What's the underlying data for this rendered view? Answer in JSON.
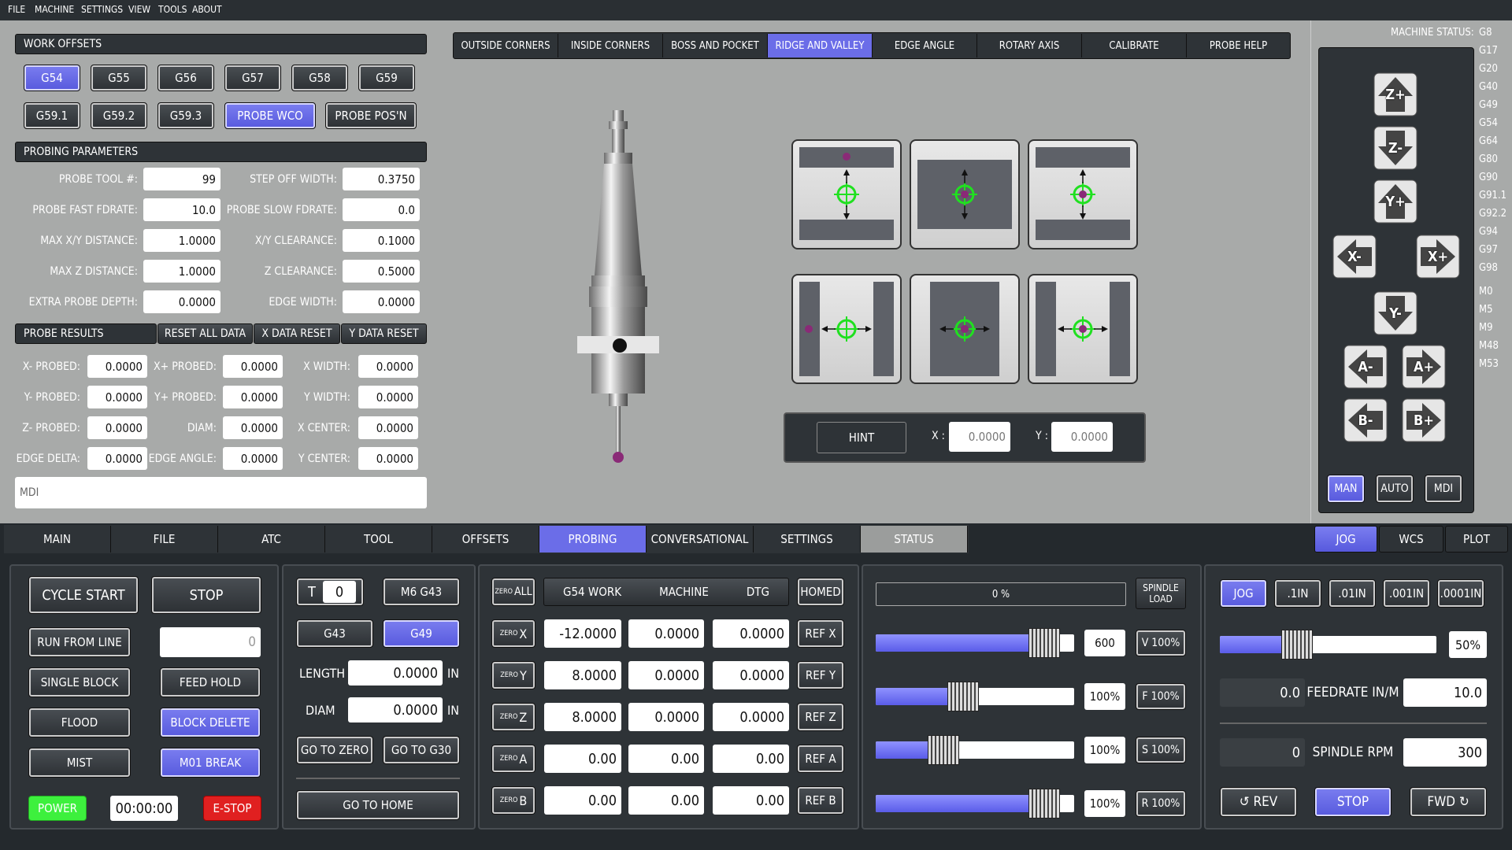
{
  "menu": [
    "FILE",
    "MACHINE",
    "SETTINGS",
    "VIEW",
    "TOOLS",
    "ABOUT"
  ],
  "work_offsets": {
    "title": "WORK OFFSETS",
    "row1": [
      "G54",
      "G55",
      "G56",
      "G57",
      "G58",
      "G59"
    ],
    "row2": [
      "G59.1",
      "G59.2",
      "G59.3",
      "PROBE WCO",
      "PROBE POS'N"
    ],
    "active": "G54"
  },
  "probing_params": {
    "title": "PROBING PARAMETERS",
    "left": [
      {
        "label": "PROBE TOOL #:",
        "value": "99"
      },
      {
        "label": "PROBE FAST FDRATE:",
        "value": "10.0"
      },
      {
        "label": "MAX X/Y DISTANCE:",
        "value": "1.0000"
      },
      {
        "label": "MAX Z DISTANCE:",
        "value": "1.0000"
      },
      {
        "label": "EXTRA PROBE DEPTH:",
        "value": "0.0000"
      }
    ],
    "right": [
      {
        "label": "STEP OFF WIDTH:",
        "value": "0.3750"
      },
      {
        "label": "PROBE SLOW FDRATE:",
        "value": "0.0"
      },
      {
        "label": "X/Y CLEARANCE:",
        "value": "0.1000"
      },
      {
        "label": "Z CLEARANCE:",
        "value": "0.5000"
      },
      {
        "label": "EDGE WIDTH:",
        "value": "0.0000"
      }
    ]
  },
  "probe_results": {
    "title": "PROBE RESULTS",
    "buttons": [
      "RESET ALL DATA",
      "X DATA RESET",
      "Y DATA RESET"
    ],
    "col1": [
      {
        "label": "X- PROBED:",
        "value": "0.0000"
      },
      {
        "label": "Y- PROBED:",
        "value": "0.0000"
      },
      {
        "label": "Z- PROBED:",
        "value": "0.0000"
      },
      {
        "label": "EDGE DELTA:",
        "value": "0.0000"
      }
    ],
    "col2": [
      {
        "label": "X+ PROBED:",
        "value": "0.0000"
      },
      {
        "label": "Y+ PROBED:",
        "value": "0.0000"
      },
      {
        "label": "DIAM:",
        "value": "0.0000"
      },
      {
        "label": "EDGE ANGLE:",
        "value": "0.0000"
      }
    ],
    "col3": [
      {
        "label": "X WIDTH:",
        "value": "0.0000"
      },
      {
        "label": "Y WIDTH:",
        "value": "0.0000"
      },
      {
        "label": "X CENTER:",
        "value": "0.0000"
      },
      {
        "label": "Y CENTER:",
        "value": "0.0000"
      }
    ]
  },
  "mdi": {
    "placeholder": "MDI"
  },
  "probe_tabs": {
    "items": [
      "OUTSIDE CORNERS",
      "INSIDE CORNERS",
      "BOSS AND POCKET",
      "RIDGE AND VALLEY",
      "EDGE ANGLE",
      "ROTARY AXIS",
      "CALIBRATE",
      "PROBE HELP"
    ],
    "active": "RIDGE AND VALLEY"
  },
  "hint": {
    "button": "HINT",
    "x_label": "X :",
    "x_value": "0.0000",
    "y_label": "Y :",
    "y_value": "0.0000"
  },
  "machine_status": {
    "title": "MACHINE STATUS:",
    "gcodes": [
      "G8",
      "G17",
      "G20",
      "G40",
      "G49",
      "G54",
      "G64",
      "G80",
      "G90",
      "G91.1",
      "G92.2",
      "G94",
      "G97",
      "G98"
    ],
    "mcodes": [
      "M0",
      "M5",
      "M9",
      "M48",
      "M53"
    ]
  },
  "jog_keys": [
    "Z+",
    "Z-",
    "Y+",
    "X-",
    "X+",
    "Y-",
    "A-",
    "A+",
    "B-",
    "B+"
  ],
  "modes": {
    "items": [
      "MAN",
      "AUTO",
      "MDI"
    ],
    "active": "MAN"
  },
  "main_tabs": {
    "items": [
      "MAIN",
      "FILE",
      "ATC",
      "TOOL",
      "OFFSETS",
      "PROBING",
      "CONVERSATIONAL",
      "SETTINGS",
      "STATUS"
    ],
    "active": "PROBING"
  },
  "right_tabs": {
    "items": [
      "JOG",
      "WCS",
      "PLOT"
    ],
    "active": "JOG"
  },
  "cycle": {
    "cycle_start": "CYCLE START",
    "stop": "STOP",
    "run_from_line": "RUN FROM LINE",
    "line_value": "0",
    "single_block": "SINGLE BLOCK",
    "feed_hold": "FEED HOLD",
    "flood": "FLOOD",
    "block_delete": "BLOCK DELETE",
    "mist": "MIST",
    "m01_break": "M01 BREAK",
    "power": "POWER",
    "timer": "00:00:00",
    "estop": "E-STOP"
  },
  "tool": {
    "t_label": "T",
    "t_value": "0",
    "m6": "M6 G43",
    "g43": "G43",
    "g49": "G49",
    "length_label": "LENGTH",
    "length_value": "0.0000",
    "diam_label": "DIAM",
    "diam_value": "0.0000",
    "unit": "IN",
    "go_zero": "GO TO ZERO",
    "go_g30": "GO TO G30",
    "go_home": "GO TO HOME"
  },
  "dro": {
    "zero_all": "ALL",
    "zero_prefix": "ZERO",
    "headers": [
      "G54 WORK",
      "MACHINE",
      "DTG"
    ],
    "homed": "HOMED",
    "rows": [
      {
        "axis": "X",
        "work": "-12.0000",
        "machine": "0.0000",
        "dtg": "0.0000",
        "ref": "REF X"
      },
      {
        "axis": "Y",
        "work": "8.0000",
        "machine": "0.0000",
        "dtg": "0.0000",
        "ref": "REF Y"
      },
      {
        "axis": "Z",
        "work": "8.0000",
        "machine": "0.0000",
        "dtg": "0.0000",
        "ref": "REF Z"
      },
      {
        "axis": "A",
        "work": "0.00",
        "machine": "0.00",
        "dtg": "0.00",
        "ref": "REF A"
      },
      {
        "axis": "B",
        "work": "0.00",
        "machine": "0.00",
        "dtg": "0.00",
        "ref": "REF B"
      }
    ]
  },
  "overrides": {
    "spindle_load_pct": "0 %",
    "spindle_load_label1": "SPINDLE",
    "spindle_load_label2": "LOAD",
    "rows": [
      {
        "value": "600",
        "button": "V 100%",
        "fill": 0.85
      },
      {
        "value": "100%",
        "button": "F 100%",
        "fill": 0.44
      },
      {
        "value": "100%",
        "button": "S 100%",
        "fill": 0.34
      },
      {
        "value": "100%",
        "button": "R 100%",
        "fill": 0.85
      }
    ]
  },
  "jog": {
    "increments": [
      "JOG",
      ".1IN",
      ".01IN",
      ".001IN",
      ".0001IN"
    ],
    "active": "JOG",
    "rate": "50%",
    "rate_fill": 0.5,
    "feed_current": "0.0",
    "feed_label": "FEEDRATE IN/M",
    "feed_set": "10.0",
    "rpm_current": "0",
    "rpm_label": "SPINDLE RPM",
    "rpm_set": "300",
    "rev": "↺ REV",
    "stop": "STOP",
    "fwd": "FWD ↻"
  },
  "colors": {
    "accent": "#6b6de8",
    "power": "#3df03d",
    "estop": "#e02020",
    "panel": "#2e3337",
    "upper_bg": "#a8aaa9"
  }
}
